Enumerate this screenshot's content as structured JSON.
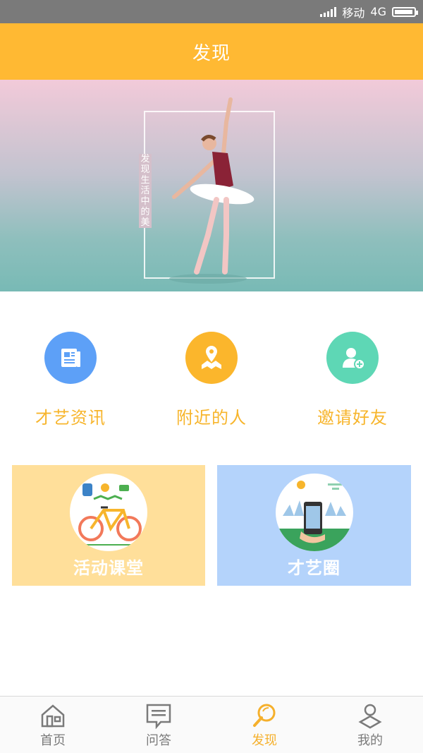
{
  "status_bar": {
    "carrier": "移动",
    "network": "4G",
    "battery_level": 0.95
  },
  "header": {
    "title": "发现"
  },
  "banner": {
    "slogan": "发现生活中的美"
  },
  "quick_actions": [
    {
      "label": "才艺资讯",
      "icon": "newspaper-icon",
      "color": "#5da0f7"
    },
    {
      "label": "附近的人",
      "icon": "location-map-icon",
      "color": "#fbb62c"
    },
    {
      "label": "邀请好友",
      "icon": "add-friend-icon",
      "color": "#5ed7b5"
    }
  ],
  "cards": [
    {
      "label": "活动课堂",
      "icon": "bicycle-activity-icon",
      "color": "#ffdf9a"
    },
    {
      "label": "才艺圈",
      "icon": "dance-phone-icon",
      "color": "#b4d3fb"
    }
  ],
  "tabs": [
    {
      "label": "首页",
      "icon": "home-icon",
      "active": false
    },
    {
      "label": "问答",
      "icon": "chat-icon",
      "active": false
    },
    {
      "label": "发现",
      "icon": "discover-search-icon",
      "active": true
    },
    {
      "label": "我的",
      "icon": "profile-icon",
      "active": false
    }
  ],
  "colors": {
    "accent": "#ffb933",
    "tab_active": "#f5b02c",
    "tab_inactive": "#7a7a7a"
  }
}
